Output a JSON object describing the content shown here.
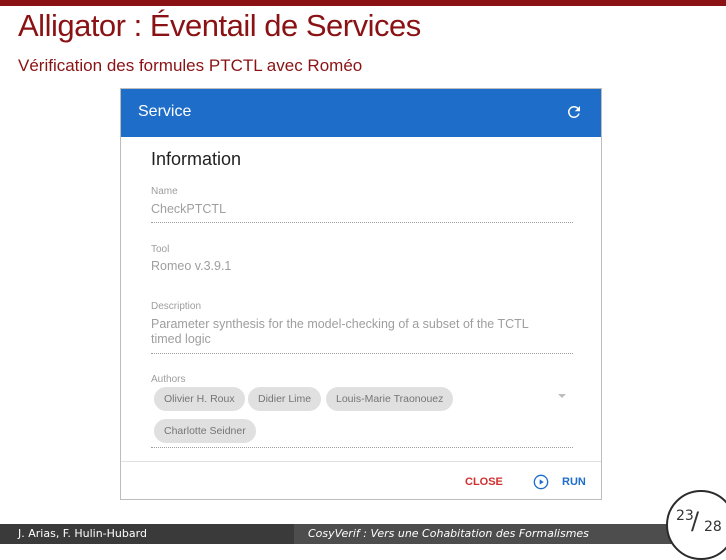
{
  "slide": {
    "title": "Alligator : Éventail de Services",
    "subtitle": "Vérification des formules PTCTL avec Roméo"
  },
  "app": {
    "title": "Service",
    "refresh_icon": "refresh-icon"
  },
  "card": {
    "heading": "Information",
    "name_label": "Name",
    "name_value": "CheckPTCTL",
    "tool_label": "Tool",
    "tool_value": "Romeo v.3.9.1",
    "description_label": "Description",
    "description_value": "Parameter synthesis for the model-checking of a subset of the TCTL timed logic",
    "authors_label": "Authors",
    "authors": [
      "Olivier H. Roux",
      "Didier Lime",
      "Louis-Marie Traonouez",
      "Charlotte Seidner"
    ]
  },
  "actions": {
    "close_label": "CLOSE",
    "run_label": "RUN"
  },
  "footer": {
    "authors": "J. Arias, F. Hulin-Hubard",
    "talk": "CosyVerif : Vers une Cohabitation des Formalismes",
    "page": "23",
    "total": "28"
  },
  "colors": {
    "accent": "#8a1214",
    "appbar": "#1e6dc9",
    "close": "#d32f2f"
  }
}
